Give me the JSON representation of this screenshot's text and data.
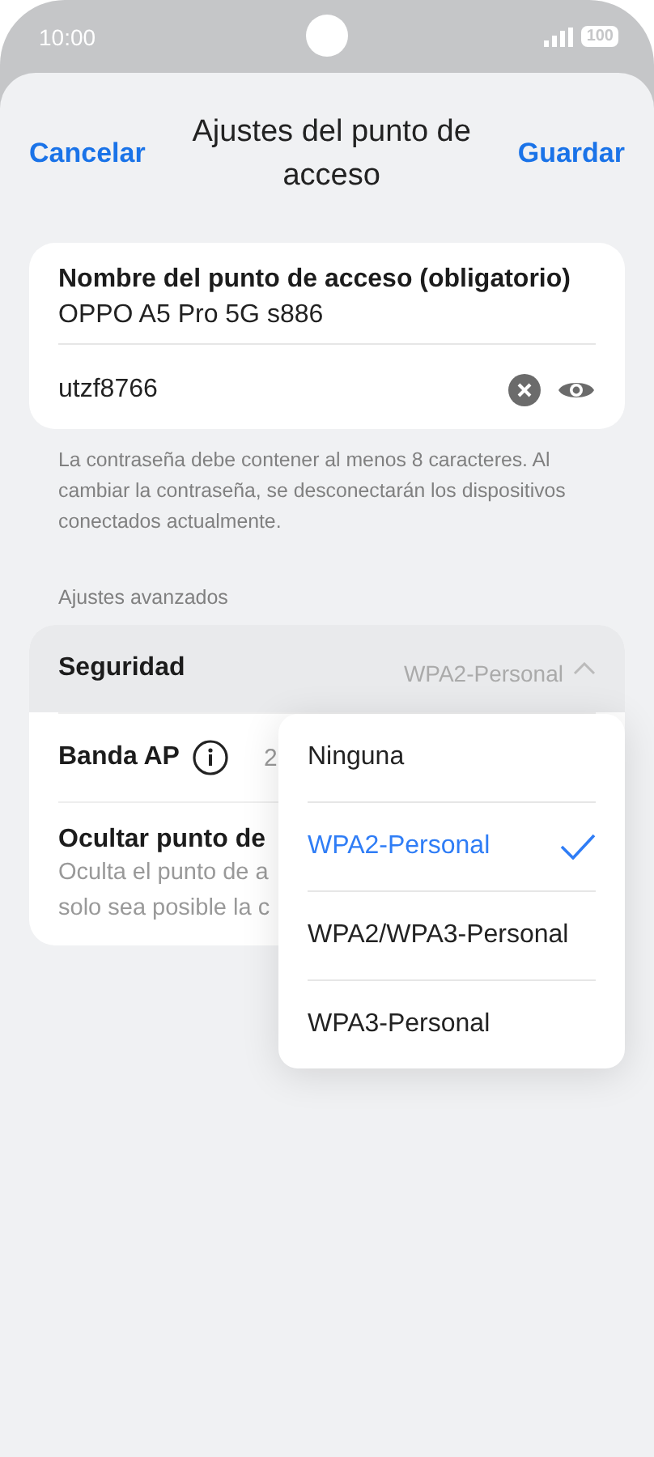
{
  "status_bar": {
    "time": "10:00",
    "battery": "100"
  },
  "header": {
    "cancel": "Cancelar",
    "title": "Ajustes del punto de acceso",
    "save": "Guardar"
  },
  "name_card": {
    "label": "Nombre del punto de acceso (obligatorio)",
    "value": "OPPO A5 Pro 5G s886",
    "password": "utzf8766"
  },
  "hint": "La contraseña debe contener al menos 8 caracteres. Al cambiar la contraseña, se desconectarán los dispositivos conectados actualmente.",
  "section_title": "Ajustes avanzados",
  "settings": [
    {
      "kind": "select",
      "label": "Seguridad",
      "value": "WPA2-Personal",
      "expanded": true
    },
    {
      "kind": "info",
      "label": "Banda AP",
      "value": "2"
    },
    {
      "kind": "toggle",
      "label": "Ocultar punto de",
      "description": [
        "Oculta el punto de a",
        "solo sea posible la c"
      ]
    }
  ],
  "dropdown": [
    {
      "label": "Ninguna",
      "selected": false
    },
    {
      "label": "WPA2-Personal",
      "selected": true
    },
    {
      "label": "WPA2/WPA3-Personal",
      "selected": false
    },
    {
      "label": "WPA3-Personal",
      "selected": false
    }
  ]
}
